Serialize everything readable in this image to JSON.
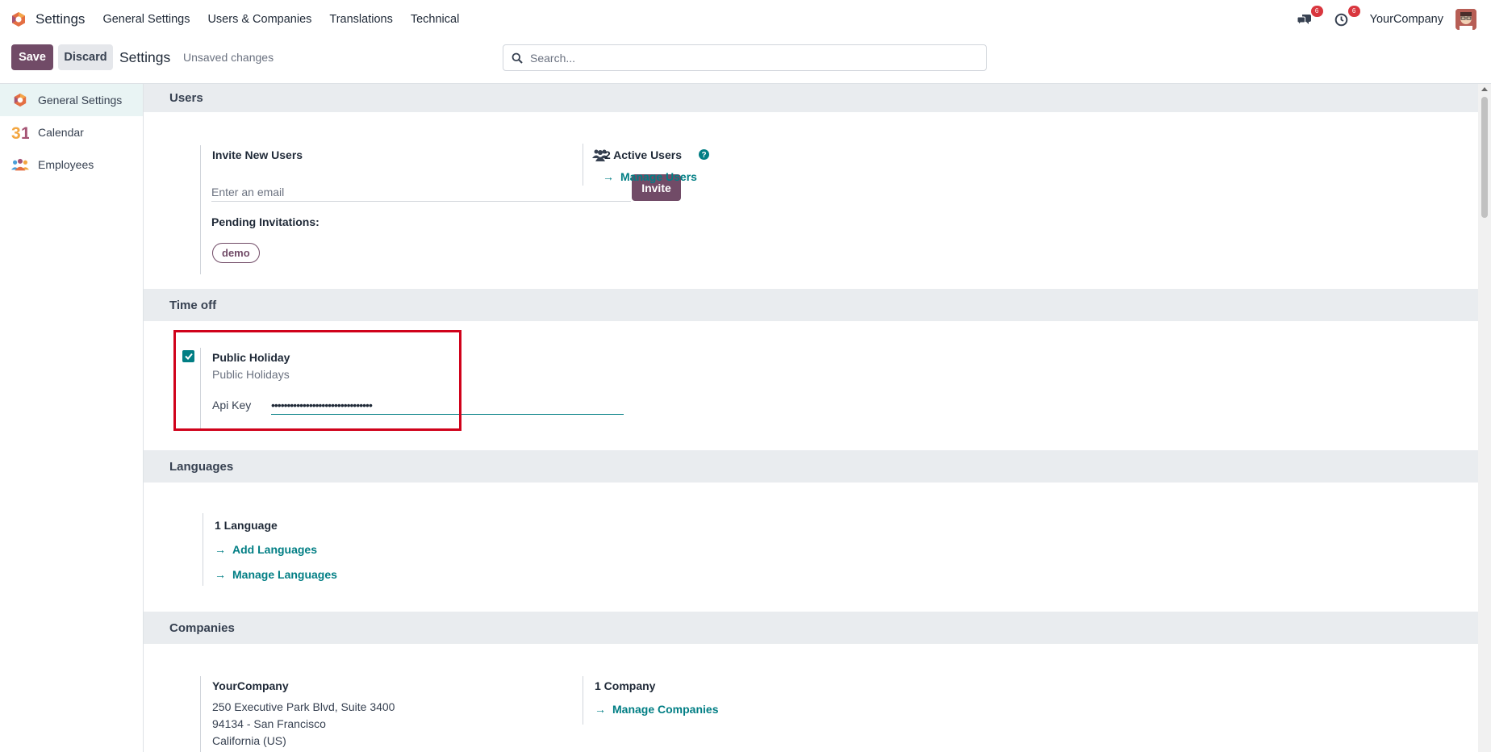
{
  "navbar": {
    "app_title": "Settings",
    "menu": [
      "General Settings",
      "Users & Companies",
      "Translations",
      "Technical"
    ],
    "messages_count": "6",
    "activities_count": "6",
    "company": "YourCompany"
  },
  "control_panel": {
    "save_label": "Save",
    "discard_label": "Discard",
    "title": "Settings",
    "status": "Unsaved changes",
    "search_placeholder": "Search..."
  },
  "sidebar": {
    "items": [
      {
        "label": "General Settings",
        "icon": "odoo-logo-icon",
        "active": true
      },
      {
        "label": "Calendar",
        "icon": "calendar-31-icon",
        "active": false
      },
      {
        "label": "Employees",
        "icon": "employees-icon",
        "active": false
      }
    ]
  },
  "users": {
    "header": "Users",
    "invite_title": "Invite New Users",
    "email_placeholder": "Enter an email",
    "invite_label": "Invite",
    "pending_label": "Pending Invitations:",
    "pending_tag": "demo",
    "active_users": "2 Active Users",
    "manage_users": "Manage Users"
  },
  "time_off": {
    "header": "Time off",
    "title": "Public Holiday",
    "subtitle": "Public Holidays",
    "checked": true,
    "api_key_label": "Api Key",
    "api_key_value": "••••••••••••••••••••••••••••••••"
  },
  "languages": {
    "header": "Languages",
    "count": "1 Language",
    "add": "Add Languages",
    "manage": "Manage Languages"
  },
  "companies": {
    "header": "Companies",
    "name": "YourCompany",
    "address_line1": "250 Executive Park Blvd, Suite 3400",
    "address_line2": "94134 - San Francisco",
    "address_line3": "California (US)",
    "count": "1 Company",
    "manage": "Manage Companies"
  },
  "colors": {
    "brand": "#714b67",
    "accent": "#017e84",
    "highlight_border": "#d0021b"
  }
}
